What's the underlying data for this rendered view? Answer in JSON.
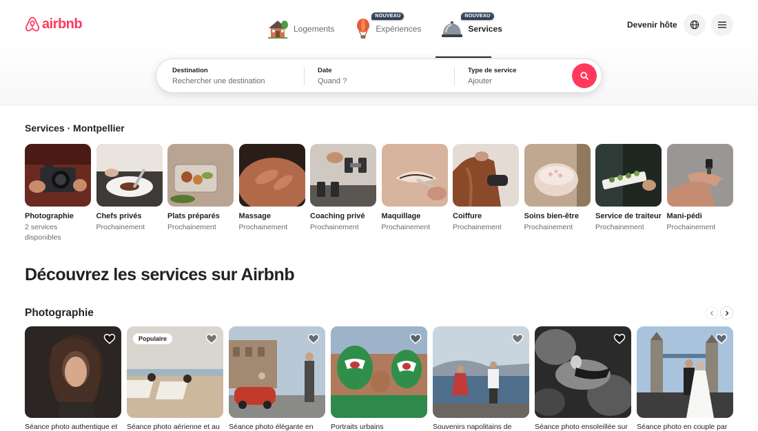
{
  "brand": {
    "name": "airbnb",
    "color": "#ff385c"
  },
  "nav": {
    "tabs": [
      {
        "label": "Logements",
        "icon": "house-icon",
        "badge": ""
      },
      {
        "label": "Expériences",
        "icon": "hot-air-balloon-icon",
        "badge": "NOUVEAU"
      },
      {
        "label": "Services",
        "icon": "service-bell-icon",
        "badge": "NOUVEAU",
        "active": true
      }
    ],
    "host_label": "Devenir hôte"
  },
  "search": {
    "destination": {
      "label": "Destination",
      "placeholder": "Rechercher une destination"
    },
    "date": {
      "label": "Date",
      "placeholder": "Quand ?"
    },
    "type": {
      "label": "Type de service",
      "placeholder": "Ajouter"
    }
  },
  "services": {
    "title": "Services · Montpellier",
    "categories": [
      {
        "name": "Photographie",
        "sub": "2 services disponibles"
      },
      {
        "name": "Chefs privés",
        "sub": "Prochainement"
      },
      {
        "name": "Plats préparés",
        "sub": "Prochainement"
      },
      {
        "name": "Massage",
        "sub": "Prochainement"
      },
      {
        "name": "Coaching privé",
        "sub": "Prochainement"
      },
      {
        "name": "Maquillage",
        "sub": "Prochainement"
      },
      {
        "name": "Coiffure",
        "sub": "Prochainement"
      },
      {
        "name": "Soins bien-être",
        "sub": "Prochainement"
      },
      {
        "name": "Service de traiteur",
        "sub": "Prochainement"
      },
      {
        "name": "Mani-pédi",
        "sub": "Prochainement"
      }
    ]
  },
  "discover": {
    "title": "Découvrez les services sur Airbnb",
    "row_title": "Photographie",
    "listings": [
      {
        "title": "Séance photo authentique et",
        "badge": ""
      },
      {
        "title": "Séance photo aérienne et au",
        "badge": "Populaire"
      },
      {
        "title": "Séance photo élégante en",
        "badge": ""
      },
      {
        "title": "Portraits urbains",
        "badge": ""
      },
      {
        "title": "Souvenirs napolitains de",
        "badge": ""
      },
      {
        "title": "Séance photo ensoleillée sur",
        "badge": ""
      },
      {
        "title": "Séance photo en couple par",
        "badge": ""
      }
    ]
  }
}
